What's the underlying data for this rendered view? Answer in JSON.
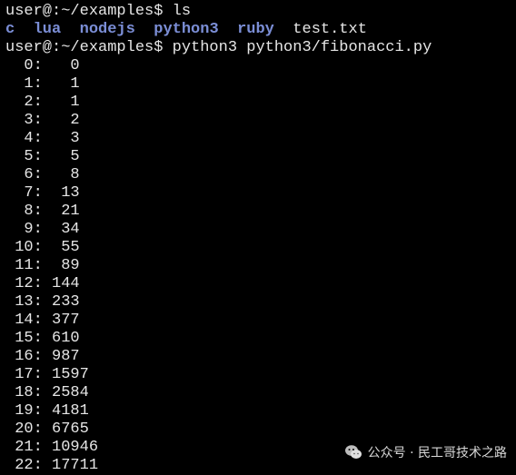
{
  "terminal": {
    "prompt1": "user@:~/examples$ ls",
    "ls_output": [
      {
        "name": "c",
        "type": "dir"
      },
      {
        "name": "lua",
        "type": "dir"
      },
      {
        "name": "nodejs",
        "type": "dir"
      },
      {
        "name": "python3",
        "type": "dir"
      },
      {
        "name": "ruby",
        "type": "dir"
      },
      {
        "name": "test.txt",
        "type": "file"
      }
    ],
    "prompt2": "user@:~/examples$ python3 python3/fibonacci.py",
    "fib_rows": [
      "  0:   0",
      "  1:   1",
      "  2:   1",
      "  3:   2",
      "  4:   3",
      "  5:   5",
      "  6:   8",
      "  7:  13",
      "  8:  21",
      "  9:  34",
      " 10:  55",
      " 11:  89",
      " 12: 144",
      " 13: 233",
      " 14: 377",
      " 15: 610",
      " 16: 987",
      " 17: 1597",
      " 18: 2584",
      " 19: 4181",
      " 20: 6765",
      " 21: 10946",
      " 22: 17711"
    ]
  },
  "watermark": {
    "text": "公众号 · 民工哥技术之路",
    "icon": "wechat-icon"
  },
  "colors": {
    "background": "#000000",
    "text": "#e6e6e6",
    "directory": "#7b8ed6"
  }
}
